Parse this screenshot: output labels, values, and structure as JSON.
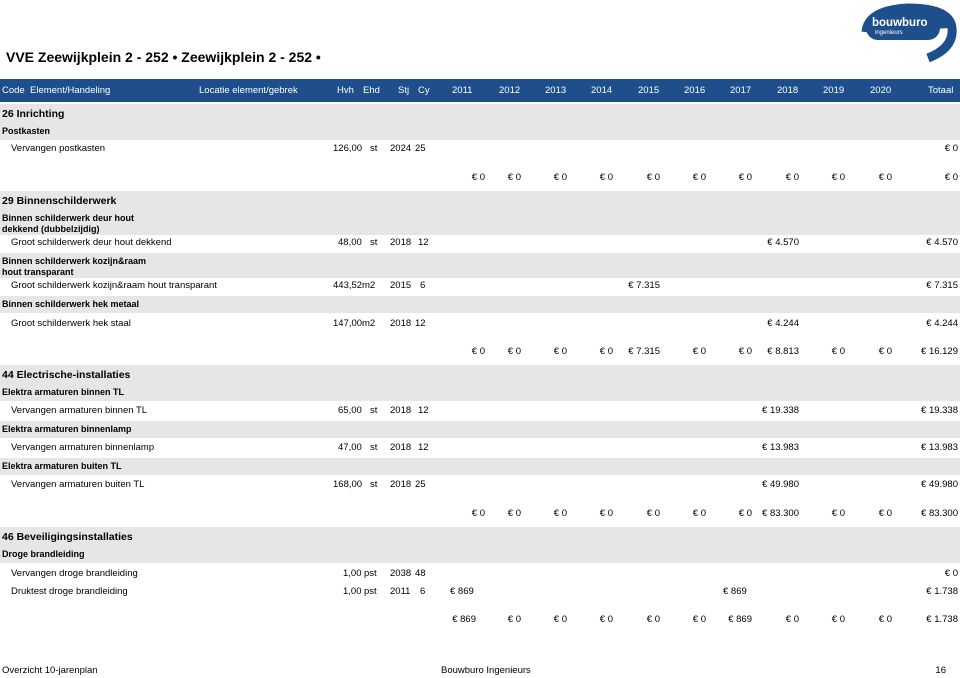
{
  "title": "VVE Zeewijkplein 2 - 252 • Zeewijkplein 2 - 252 •",
  "logo": {
    "name": "bouwburo",
    "sub": "ingenieurs",
    "color": "#1f4e8c"
  },
  "header": {
    "code": "Code",
    "element": "Element/Handeling",
    "locatie": "Locatie element/gebrek",
    "hvh": "Hvh",
    "ehd": "Ehd",
    "stj": "Stj",
    "cy": "Cy",
    "years": [
      "2011",
      "2012",
      "2013",
      "2014",
      "2015",
      "2016",
      "2017",
      "2018",
      "2019",
      "2020"
    ],
    "total": "Totaal"
  },
  "sections": {
    "s26": "26  Inrichting",
    "s29": "29  Binnenschilderwerk",
    "s44": "44  Electrische-installaties",
    "s46": "46  Beveiligingsinstallaties"
  },
  "groups": {
    "postkasten": "Postkasten",
    "deur": "Binnen schilderwerk deur hout dekkend (dubbelzijdig)",
    "kozijn": "Binnen schilderwerk kozijn&raam hout transparant",
    "hek": "Binnen schilderwerk hek metaal",
    "tl": "Elektra armaturen binnen TL",
    "lamp": "Elektra armaturen binnenlamp",
    "buiten": "Elektra armaturen buiten TL",
    "brand": "Droge brandleiding"
  },
  "rows": {
    "postkasten": {
      "desc": "Vervangen postkasten",
      "hvh": "126,00",
      "ehd": "st",
      "stj": "2024",
      "cy": "25",
      "total": "€  0"
    },
    "deur": {
      "desc": "Groot schilderwerk deur hout dekkend",
      "hvh": "48,00",
      "ehd": "st",
      "stj": "2018",
      "cy": "12",
      "y2018": "€  4.570",
      "total": "€  4.570"
    },
    "kozijn": {
      "desc": "Groot schilderwerk kozijn&raam hout transparant",
      "hvh": "443,52",
      "ehd": "m2",
      "stj": "2015",
      "cy": "6",
      "y2015": "€  7.315",
      "total": "€  7.315"
    },
    "hek": {
      "desc": "Groot schilderwerk hek staal",
      "hvh": "147,00",
      "ehd": "m2",
      "stj": "2018",
      "cy": "12",
      "y2018": "€  4.244",
      "total": "€  4.244"
    },
    "tl": {
      "desc": "Vervangen armaturen binnen TL",
      "hvh": "65,00",
      "ehd": "st",
      "stj": "2018",
      "cy": "12",
      "y2018": "€  19.338",
      "total": "€  19.338"
    },
    "lamp": {
      "desc": "Vervangen armaturen binnenlamp",
      "hvh": "47,00",
      "ehd": "st",
      "stj": "2018",
      "cy": "12",
      "y2018": "€  13.983",
      "total": "€  13.983"
    },
    "buiten": {
      "desc": "Vervangen armaturen buiten TL",
      "hvh": "168,00",
      "ehd": "st",
      "stj": "2018",
      "cy": "25",
      "y2018": "€  49.980",
      "total": "€  49.980"
    },
    "brand1": {
      "desc": "Vervangen droge brandleiding",
      "hvh": "1,00",
      "ehd": "pst",
      "stj": "2038",
      "cy": "48",
      "total": "€  0"
    },
    "brand2": {
      "desc": "Druktest droge brandleiding",
      "hvh": "1,00",
      "ehd": "pst",
      "stj": "2011",
      "cy": "6",
      "y2011": "€  869",
      "y2017": "€  869",
      "total": "€  1.738"
    }
  },
  "totals": {
    "t26": [
      "€  0",
      "€  0",
      "€  0",
      "€  0",
      "€  0",
      "€  0",
      "€  0",
      "€  0",
      "€  0",
      "€  0",
      "€  0"
    ],
    "t29": [
      "€  0",
      "€  0",
      "€  0",
      "€  0",
      "€  7.315",
      "€  0",
      "€  0",
      "€  8.813",
      "€  0",
      "€  0",
      "€  16.129"
    ],
    "t44": [
      "€  0",
      "€  0",
      "€  0",
      "€  0",
      "€  0",
      "€  0",
      "€  0",
      "€  83.300",
      "€  0",
      "€  0",
      "€  83.300"
    ],
    "t46": [
      "€  869",
      "€  0",
      "€  0",
      "€  0",
      "€  0",
      "€  0",
      "€  869",
      "€  0",
      "€  0",
      "€  0",
      "€  1.738"
    ]
  },
  "footer": {
    "left": "Overzicht 10-jarenplan",
    "center": "Bouwburo Ingenieurs",
    "page": "16"
  }
}
